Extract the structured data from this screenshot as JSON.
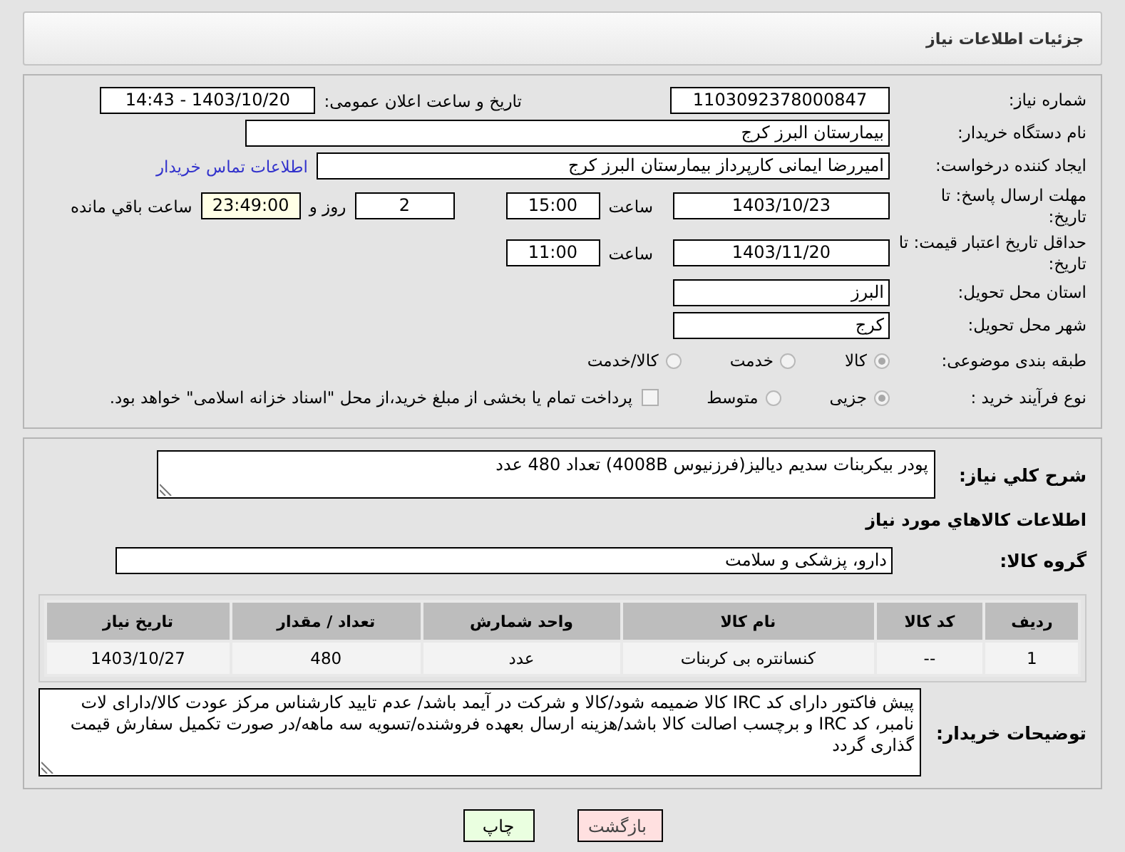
{
  "header": {
    "title": "جزئیات اطلاعات نیاز"
  },
  "need_number": {
    "label": "شماره نیاز:",
    "value": "1103092378000847"
  },
  "announce": {
    "label": "تاریخ و ساعت اعلان عمومی:",
    "value": "1403/10/20 - 14:43"
  },
  "buyer_org": {
    "label": "نام دستگاه خریدار:",
    "value": "بیمارستان البرز کرج"
  },
  "requester": {
    "label": "ایجاد کننده درخواست:",
    "value": "امیررضا ایمانی کارپرداز بیمارستان البرز کرج",
    "link": "اطلاعات تماس خریدار"
  },
  "reply_deadline": {
    "label": "مهلت ارسال پاسخ: تا تاریخ:",
    "date": "1403/10/23",
    "time_label": "ساعت",
    "time": "15:00",
    "days": "2",
    "days_label": "روز و",
    "remaining": "23:49:00",
    "remaining_label": "ساعت باقي مانده"
  },
  "price_validity": {
    "label": "حداقل تاریخ اعتبار قیمت: تا تاریخ:",
    "date": "1403/11/20",
    "time_label": "ساعت",
    "time": "11:00"
  },
  "province": {
    "label": "استان محل تحویل:",
    "value": "البرز"
  },
  "city": {
    "label": "شهر محل تحویل:",
    "value": "کرج"
  },
  "category": {
    "label": "طبقه بندی موضوعی:",
    "options": [
      {
        "label": "کالا",
        "selected": true
      },
      {
        "label": "خدمت",
        "selected": false
      },
      {
        "label": "کالا/خدمت",
        "selected": false
      }
    ]
  },
  "process": {
    "label": "نوع فرآیند خرید :",
    "options": [
      {
        "label": "جزیی",
        "selected": true
      },
      {
        "label": "متوسط",
        "selected": false
      }
    ],
    "payment": {
      "label": "پرداخت تمام یا بخشی از مبلغ خرید،از محل \"اسناد خزانه اسلامی\" خواهد بود.",
      "checked": false
    }
  },
  "description": {
    "label": "شرح کلي نیاز:",
    "value": "پودر بیکربنات سدیم دیالیز(فرزنیوس 4008B) تعداد 480 عدد"
  },
  "goods_section": {
    "title": "اطلاعات کالاهاي مورد نیاز"
  },
  "goods_group": {
    "label": "گروه کالا:",
    "value": "دارو، پزشکی و سلامت"
  },
  "table": {
    "columns": [
      "ردیف",
      "کد کالا",
      "نام کالا",
      "واحد شمارش",
      "تعداد / مقدار",
      "تاریخ نیاز"
    ],
    "rows": [
      [
        "1",
        "--",
        "کنسانتره بی کربنات",
        "عدد",
        "480",
        "1403/10/27"
      ]
    ]
  },
  "buyer_notes": {
    "label": "توضیحات خریدار:",
    "value": "پیش فاکتور دارای کد IRC کالا ضمیمه شود/کالا و شرکت در آیمد باشد/ عدم تایید کارشناس مرکز عودت کالا/دارای لات نامبر، کد IRC و برچسب اصالت کالا باشد/هزینه ارسال بعهده فروشنده/تسویه سه ماهه/در صورت تکمیل سفارش قیمت گذاری گردد"
  },
  "buttons": [
    {
      "label": "بازگشت",
      "kind": "back"
    },
    {
      "label": "چاپ",
      "kind": "print"
    }
  ]
}
